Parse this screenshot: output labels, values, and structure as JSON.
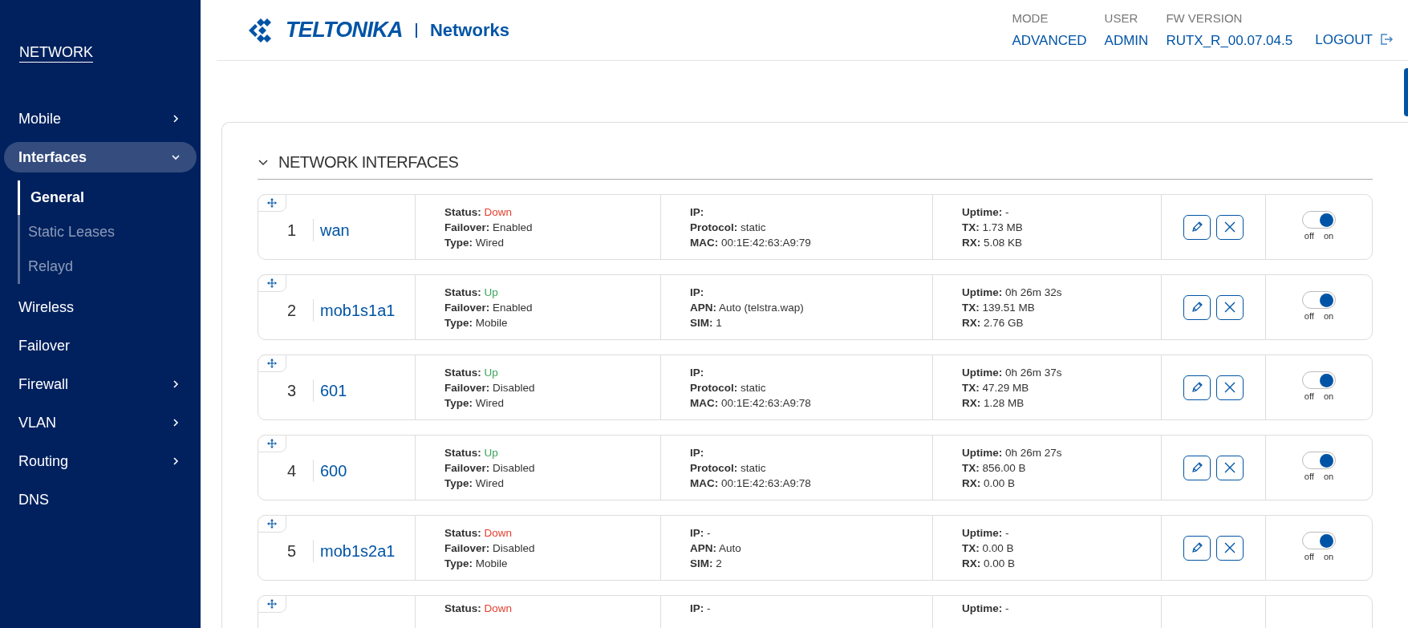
{
  "sidebar": {
    "title": "NETWORK",
    "items": [
      {
        "label": "Mobile",
        "kind": "submenu",
        "expanded": false,
        "selected": false
      },
      {
        "label": "Interfaces",
        "kind": "submenu",
        "expanded": true,
        "selected": true,
        "children": [
          {
            "label": "General",
            "selected": true
          },
          {
            "label": "Static Leases",
            "selected": false
          },
          {
            "label": "Relayd",
            "selected": false
          }
        ]
      },
      {
        "label": "Wireless",
        "kind": "link",
        "selected": false
      },
      {
        "label": "Failover",
        "kind": "link",
        "selected": false
      },
      {
        "label": "Firewall",
        "kind": "submenu",
        "expanded": false,
        "selected": false
      },
      {
        "label": "VLAN",
        "kind": "submenu",
        "expanded": false,
        "selected": false
      },
      {
        "label": "Routing",
        "kind": "submenu",
        "expanded": false,
        "selected": false
      },
      {
        "label": "DNS",
        "kind": "link",
        "selected": false
      }
    ]
  },
  "header": {
    "logo": {
      "brand": "TELTONIKA",
      "product": "Networks"
    },
    "info": [
      {
        "label": "MODE",
        "value": "ADVANCED"
      },
      {
        "label": "USER",
        "value": "ADMIN"
      },
      {
        "label": "FW VERSION",
        "value": "RUTX_R_00.07.04.5"
      }
    ],
    "logout": "LOGOUT"
  },
  "section": {
    "title": "NETWORK INTERFACES",
    "expanded": true
  },
  "interfaces": [
    {
      "index": "1",
      "name": "wan",
      "status": {
        "label": "Status:",
        "value": "Down",
        "up": false
      },
      "col2": [
        {
          "label": "Failover:",
          "value": "Enabled"
        },
        {
          "label": "Type:",
          "value": "Wired"
        }
      ],
      "col3": [
        {
          "label": "IP:"
        },
        {
          "label": "Protocol:",
          "value": "static"
        },
        {
          "label": "MAC:",
          "value": "00:1E:42:63:A9:79"
        }
      ],
      "col4": [
        {
          "label": "Uptime:",
          "value": "-"
        },
        {
          "label": "TX:",
          "value": "1.73 MB"
        },
        {
          "label": "RX:",
          "value": "5.08 KB"
        }
      ],
      "enabled": true,
      "off": "off",
      "on": "on"
    },
    {
      "index": "2",
      "name": "mob1s1a1",
      "status": {
        "label": "Status:",
        "value": "Up",
        "up": true
      },
      "col2": [
        {
          "label": "Failover:",
          "value": "Enabled"
        },
        {
          "label": "Type:",
          "value": "Mobile"
        }
      ],
      "col3": [
        {
          "label": "IP:"
        },
        {
          "label": "APN:",
          "value": "Auto (telstra.wap)"
        },
        {
          "label": "SIM:",
          "value": "1"
        }
      ],
      "col4": [
        {
          "label": "Uptime:",
          "value": "0h 26m 32s"
        },
        {
          "label": "TX:",
          "value": "139.51 MB"
        },
        {
          "label": "RX:",
          "value": "2.76 GB"
        }
      ],
      "enabled": true,
      "off": "off",
      "on": "on"
    },
    {
      "index": "3",
      "name": "601",
      "status": {
        "label": "Status:",
        "value": "Up",
        "up": true
      },
      "col2": [
        {
          "label": "Failover:",
          "value": "Disabled"
        },
        {
          "label": "Type:",
          "value": "Wired"
        }
      ],
      "col3": [
        {
          "label": "IP:"
        },
        {
          "label": "Protocol:",
          "value": "static"
        },
        {
          "label": "MAC:",
          "value": "00:1E:42:63:A9:78"
        }
      ],
      "col4": [
        {
          "label": "Uptime:",
          "value": "0h 26m 37s"
        },
        {
          "label": "TX:",
          "value": "47.29 MB"
        },
        {
          "label": "RX:",
          "value": "1.28 MB"
        }
      ],
      "enabled": true,
      "off": "off",
      "on": "on"
    },
    {
      "index": "4",
      "name": "600",
      "status": {
        "label": "Status:",
        "value": "Up",
        "up": true
      },
      "col2": [
        {
          "label": "Failover:",
          "value": "Disabled"
        },
        {
          "label": "Type:",
          "value": "Wired"
        }
      ],
      "col3": [
        {
          "label": "IP:"
        },
        {
          "label": "Protocol:",
          "value": "static"
        },
        {
          "label": "MAC:",
          "value": "00:1E:42:63:A9:78"
        }
      ],
      "col4": [
        {
          "label": "Uptime:",
          "value": "0h 26m 27s"
        },
        {
          "label": "TX:",
          "value": "856.00 B"
        },
        {
          "label": "RX:",
          "value": "0.00 B"
        }
      ],
      "enabled": true,
      "off": "off",
      "on": "on"
    },
    {
      "index": "5",
      "name": "mob1s2a1",
      "status": {
        "label": "Status:",
        "value": "Down",
        "up": false
      },
      "col2": [
        {
          "label": "Failover:",
          "value": "Disabled"
        },
        {
          "label": "Type:",
          "value": "Mobile"
        }
      ],
      "col3": [
        {
          "label": "IP:",
          "value": "-"
        },
        {
          "label": "APN:",
          "value": "Auto"
        },
        {
          "label": "SIM:",
          "value": "2"
        }
      ],
      "col4": [
        {
          "label": "Uptime:",
          "value": "-"
        },
        {
          "label": "TX:",
          "value": "0.00 B"
        },
        {
          "label": "RX:",
          "value": "0.00 B"
        }
      ],
      "enabled": true,
      "off": "off",
      "on": "on"
    },
    {
      "status": {
        "label": "Status:",
        "value": "Down",
        "up": false
      },
      "col3": [
        {
          "label": "IP:",
          "value": "-"
        }
      ],
      "col4": [
        {
          "label": "Uptime:",
          "value": "-"
        }
      ]
    }
  ]
}
